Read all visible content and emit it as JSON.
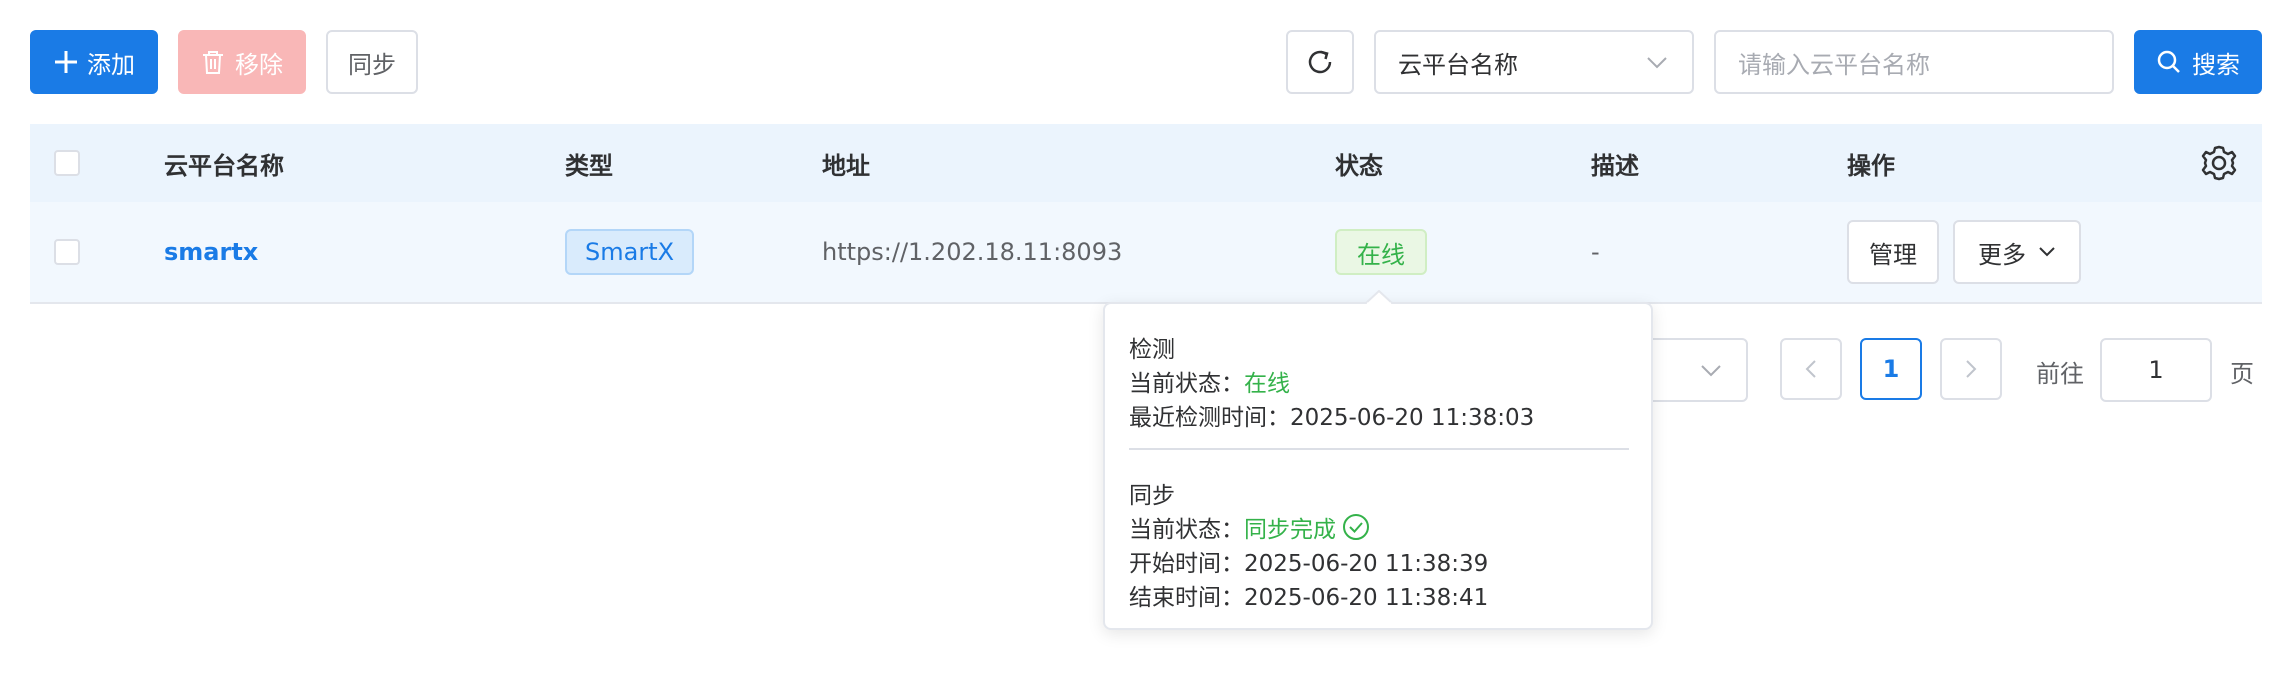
{
  "toolbar": {
    "add_label": "添加",
    "remove_label": "移除",
    "sync_label": "同步",
    "filter_select_value": "云平台名称",
    "search_placeholder": "请输入云平台名称",
    "search_label": "搜索"
  },
  "table": {
    "headers": {
      "name": "云平台名称",
      "type": "类型",
      "address": "地址",
      "status": "状态",
      "description": "描述",
      "actions": "操作"
    },
    "rows": [
      {
        "name": "smartx",
        "type": "SmartX",
        "address": "https://1.202.18.11:8093",
        "status": "在线",
        "description": "-",
        "manage_label": "管理",
        "more_label": "更多"
      }
    ]
  },
  "popover": {
    "detect_title": "检测",
    "detect_status_label": "当前状态：",
    "detect_status_value": "在线",
    "detect_time_label": "最近检测时间：",
    "detect_time_value": "2025-06-20 11:38:03",
    "sync_title": "同步",
    "sync_status_label": "当前状态：",
    "sync_status_value": "同步完成",
    "sync_start_label": "开始时间：",
    "sync_start_value": "2025-06-20 11:38:39",
    "sync_end_label": "结束时间：",
    "sync_end_value": "2025-06-20 11:38:41"
  },
  "pagination": {
    "current_page": "1",
    "goto_label": "前往",
    "goto_value": "1",
    "page_suffix": "页"
  },
  "colors": {
    "primary": "#1a7be6",
    "danger_disabled": "#f9b7b7",
    "success": "#34b24a",
    "header_bg": "#ebf4fd"
  }
}
